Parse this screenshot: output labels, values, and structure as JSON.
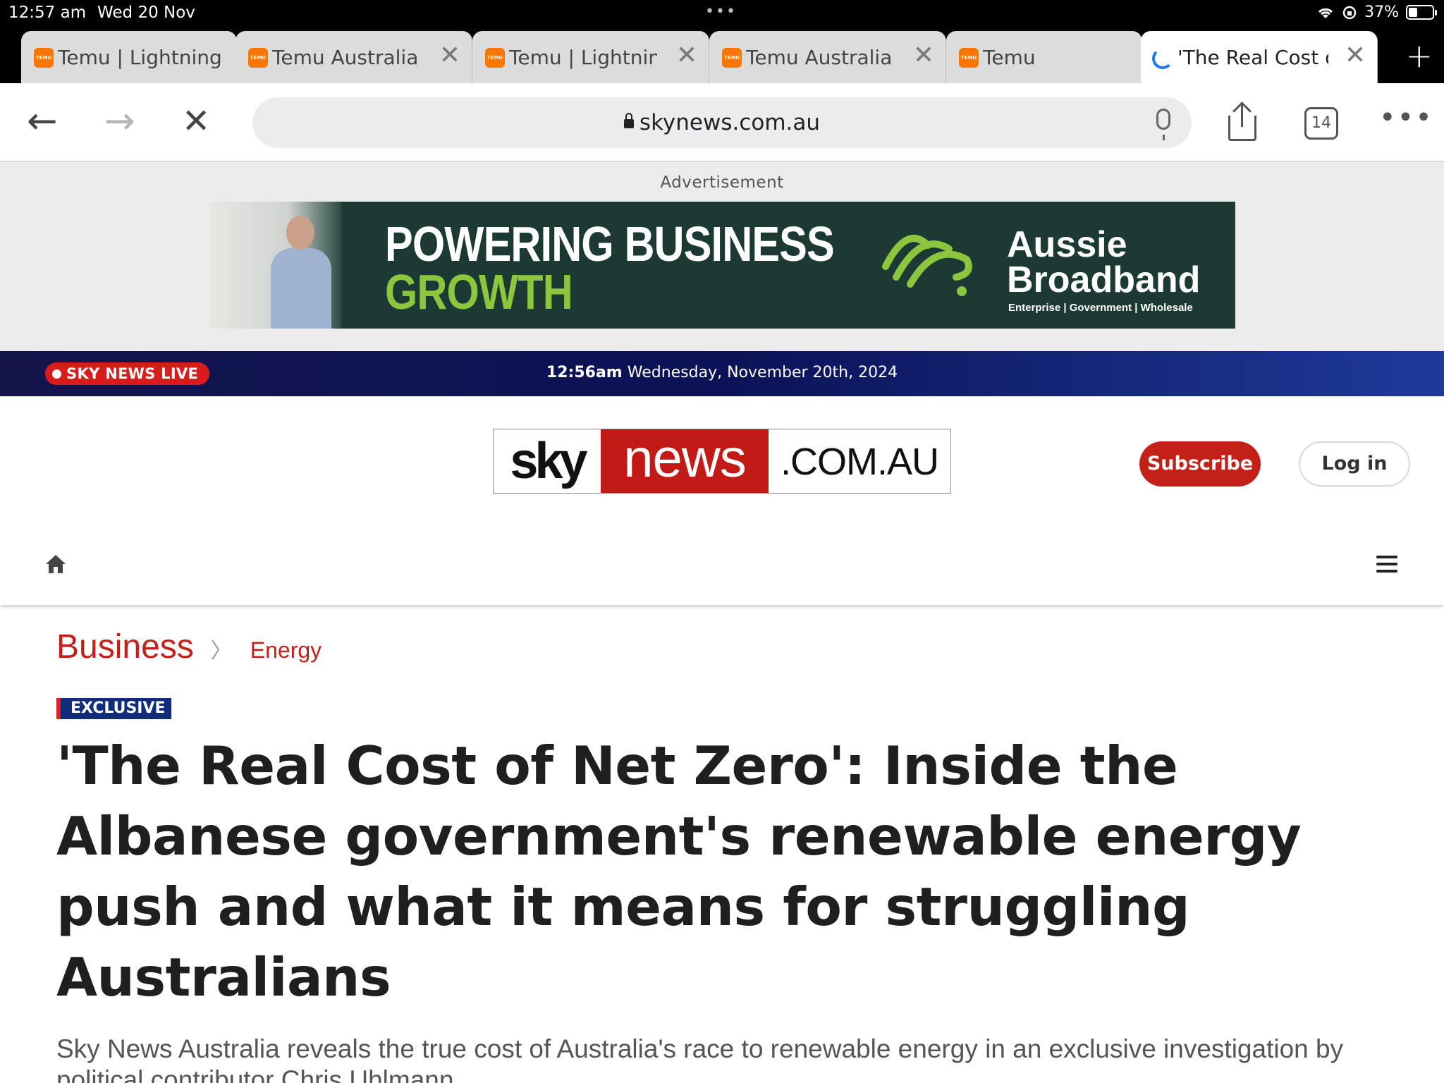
{
  "status_bar": {
    "time": "12:57 am",
    "date": "Wed 20 Nov",
    "battery": "37%",
    "battery_level": 0.37
  },
  "tabs": [
    {
      "label": "Temu | Lightning",
      "favicon": "temu-favicon"
    },
    {
      "label": "Temu Australia",
      "favicon": "temu-favicon"
    },
    {
      "label": "Temu | Lightning",
      "favicon": "temu-favicon"
    },
    {
      "label": "Temu Australia",
      "favicon": "temu-favicon"
    },
    {
      "label": "Temu",
      "favicon": "temu-favicon"
    },
    {
      "label": "'The Real Cost of",
      "favicon": "loading-spinner",
      "active": true
    }
  ],
  "toolbar": {
    "url": "skynews.com.au",
    "tab_count": "14"
  },
  "ad": {
    "label": "Advertisement",
    "headline_1": "POWERING BUSINESS",
    "headline_2": "GROWTH",
    "brand_line_1": "Aussie",
    "brand_line_2": "Broadband",
    "brand_sub": "Enterprise | Government | Wholesale"
  },
  "live_bar": {
    "live_label": "SKY NEWS LIVE",
    "time": "12:56am",
    "date": "Wednesday, November 20th, 2024"
  },
  "header": {
    "logo_sky": "sky",
    "logo_news": "news",
    "logo_domain": ".COM.AU",
    "subscribe_label": "Subscribe",
    "login_label": "Log in"
  },
  "article": {
    "section": "Business",
    "subsection": "Energy",
    "badge": "EXCLUSIVE",
    "headline": "'The Real Cost of Net Zero': Inside the Albanese government's renewable energy push and what it means for struggling Australians",
    "standfirst": "Sky News Australia reveals the true cost of Australia's race to renewable energy in an exclusive investigation by political contributor Chris Uhlmann."
  },
  "colors": {
    "brand_red": "#c4201a",
    "live_navy": "#0b1257",
    "temu_orange": "#fb7701",
    "ad_green": "#8cc63f"
  }
}
